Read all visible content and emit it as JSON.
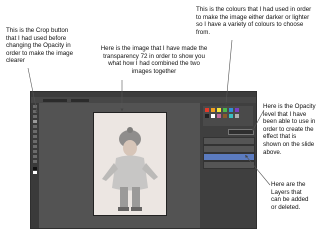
{
  "annotations": {
    "crop_note": "This is the Crop button\nthat I had used before\nchanging the Opacity in\norder to make the image\nclearer",
    "image_note": "Here is the image that I have made the\ntransparency 72 in order to show you\nwhat how I had combined the two\nimages together",
    "colours_note": "This is the colours that I had used in order\nto make the image either darker or lighter\nso I have a variety of colours to choose\nfrom.",
    "opacity_note": "Here is the Opacity\nlevel that I have\nbeen able to use in\norder to create the\neffect that is\nshown on the slide\nabove.",
    "layers_note": "Here are the\nLayers that\ncan be added\nor deleted."
  },
  "photoshop": {
    "image_opacity_percent": 72,
    "accent_color": "#5b7bbf",
    "swatch_colors": [
      "#e23a2a",
      "#f0a020",
      "#f5e63a",
      "#4cb84c",
      "#2f8fd8",
      "#7a3fc0",
      "#222222",
      "#ffffff",
      "#c46a9c",
      "#8a5a2b",
      "#3ac0c0",
      "#b0b0b0"
    ]
  }
}
